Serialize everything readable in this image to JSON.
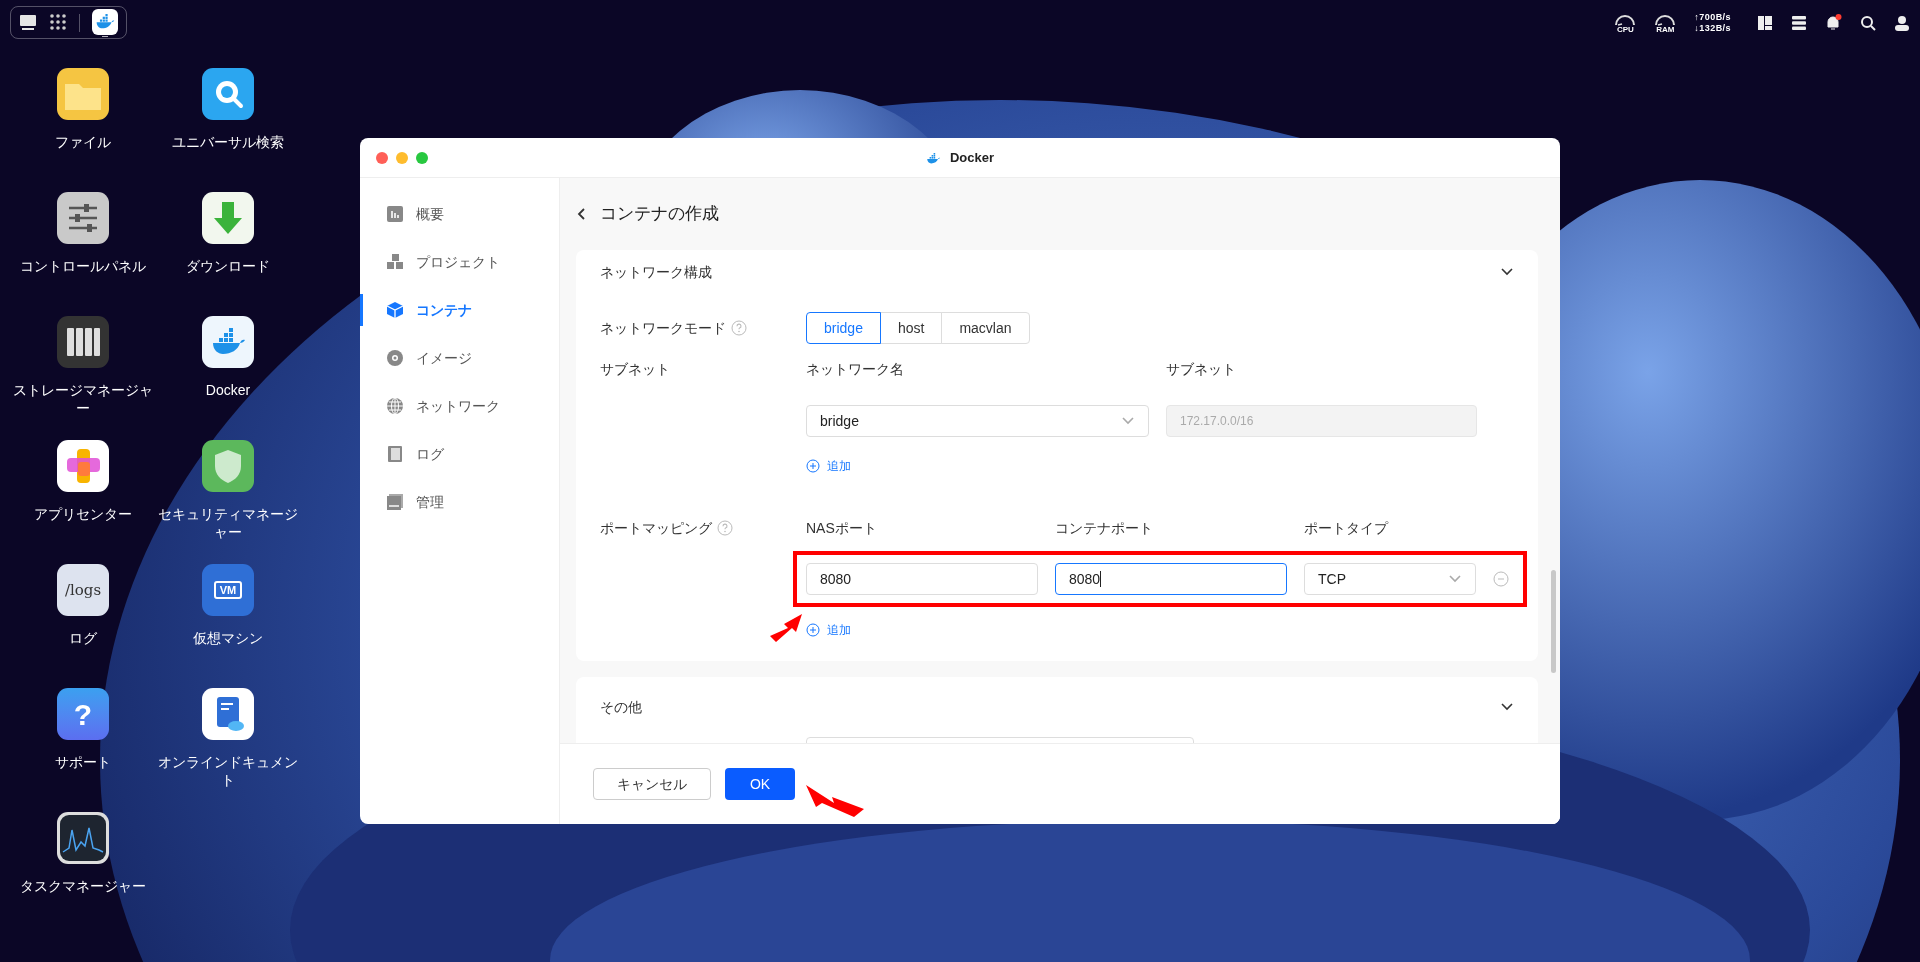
{
  "dock": {
    "apps": [
      {
        "kind": "desktop",
        "selected": false
      },
      {
        "kind": "apps",
        "selected": false
      },
      {
        "kind": "docker",
        "selected": true
      }
    ]
  },
  "status_bar": {
    "cpu_label": "CPU",
    "ram_label": "RAM",
    "upload": "↑700B/s",
    "download": "↓132B/s",
    "unread_notifications": true
  },
  "desktop_icons": [
    {
      "kind": "files",
      "label": "ファイル"
    },
    {
      "kind": "search",
      "label": "ユニバーサル検索"
    },
    {
      "kind": "control",
      "label": "コントロールパネル"
    },
    {
      "kind": "download",
      "label": "ダウンロード"
    },
    {
      "kind": "storage",
      "label": "ストレージマネージャー"
    },
    {
      "kind": "docker",
      "label": "Docker"
    },
    {
      "kind": "appcenter",
      "label": "アプリセンター"
    },
    {
      "kind": "security",
      "label": "セキュリティマネージャー"
    },
    {
      "kind": "logs",
      "label": "ログ",
      "icon_text": "/logs"
    },
    {
      "kind": "vm",
      "label": "仮想マシン",
      "icon_text": "VM"
    },
    {
      "kind": "support",
      "label": "サポート",
      "icon_text": "?"
    },
    {
      "kind": "docs",
      "label": "オンラインドキュメント"
    },
    {
      "kind": "taskmanager",
      "label": "タスクマネージャー"
    }
  ],
  "window": {
    "title": "Docker",
    "sidebar": {
      "items": [
        {
          "kind": "overview",
          "label": "概要",
          "selected": false
        },
        {
          "kind": "project",
          "label": "プロジェクト",
          "selected": false
        },
        {
          "kind": "container",
          "label": "コンテナ",
          "selected": true
        },
        {
          "kind": "image",
          "label": "イメージ",
          "selected": false
        },
        {
          "kind": "network",
          "label": "ネットワーク",
          "selected": false
        },
        {
          "kind": "log",
          "label": "ログ",
          "selected": false
        },
        {
          "kind": "manage",
          "label": "管理",
          "selected": false
        }
      ]
    },
    "page_title": "コンテナの作成",
    "network_section": {
      "title": "ネットワーク構成",
      "expanded": true,
      "network_mode": {
        "label": "ネットワークモード",
        "options": [
          {
            "label": "bridge",
            "selected": true
          },
          {
            "label": "host",
            "selected": false
          },
          {
            "label": "macvlan",
            "selected": false
          }
        ]
      },
      "subnet": {
        "label": "サブネット",
        "network_name_header": "ネットワーク名",
        "subnet_header": "サブネット",
        "network_name": "bridge",
        "subnet_value": "172.17.0.0/16",
        "subnet_disabled": true,
        "add_link": "追加"
      },
      "port_mapping": {
        "label": "ポートマッピング",
        "headers": [
          "NASポート",
          "コンテナポート",
          "ポートタイプ"
        ],
        "rows": [
          {
            "nas_port": "8080",
            "container_port": "8080",
            "container_port_focused": true,
            "port_type": "TCP",
            "highlighted": true
          }
        ],
        "add_link": "追加"
      }
    },
    "other_section": {
      "title": "その他",
      "expanded": true
    },
    "buttons": [
      {
        "kind": "secondary",
        "label": "キャンセル"
      },
      {
        "kind": "primary",
        "label": "OK"
      }
    ]
  }
}
